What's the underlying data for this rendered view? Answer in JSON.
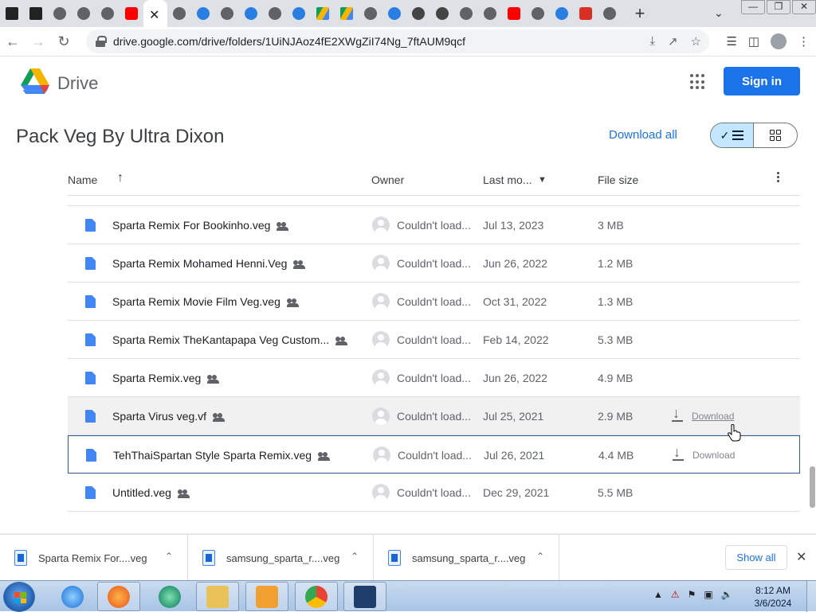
{
  "browser": {
    "url": "drive.google.com/drive/folders/1UiNJAoz4fE2XWgZiI74Ng_7ftAUM9qcf",
    "tab_close_glyph": "✕",
    "new_tab_glyph": "+",
    "tab_list_glyph": "⌄",
    "window_buttons": [
      "—",
      "❐",
      "✕"
    ],
    "tab_favicons": [
      "archive-icon",
      "archive-icon",
      "site-icon",
      "site-icon",
      "site-icon",
      "youtube-icon",
      "close-icon",
      "site-icon",
      "cloud-icon",
      "site-icon",
      "cloud-icon",
      "site-icon",
      "cloud-icon",
      "drive-icon",
      "drive-icon",
      "site-icon",
      "cloud-icon",
      "chrome-icon",
      "chrome-icon",
      "site-icon",
      "site-icon",
      "youtube-icon",
      "site-icon",
      "cloud-icon",
      "download-icon",
      "site-icon"
    ]
  },
  "drive": {
    "app_name": "Drive",
    "sign_in": "Sign in",
    "folder_title": "Pack Veg By Ultra Dixon",
    "download_all": "Download all",
    "columns": {
      "name": "Name",
      "owner": "Owner",
      "modified": "Last mo...",
      "size": "File size"
    },
    "files": [
      {
        "name": "Sparta Remix For Bookinho.veg",
        "owner": "Couldn't load...",
        "date": "Jul 13, 2023",
        "size": "3 MB"
      },
      {
        "name": "Sparta Remix Mohamed Henni.Veg",
        "owner": "Couldn't load...",
        "date": "Jun 26, 2022",
        "size": "1.2 MB"
      },
      {
        "name": "Sparta Remix Movie Film Veg.veg",
        "owner": "Couldn't load...",
        "date": "Oct 31, 2022",
        "size": "1.3 MB"
      },
      {
        "name": "Sparta Remix TheKantapapa Veg Custom...",
        "owner": "Couldn't load...",
        "date": "Feb 14, 2022",
        "size": "5.3 MB"
      },
      {
        "name": "Sparta Remix.veg",
        "owner": "Couldn't load...",
        "date": "Jun 26, 2022",
        "size": "4.9 MB"
      },
      {
        "name": "Sparta Virus veg.vf",
        "owner": "Couldn't load...",
        "date": "Jul 25, 2021",
        "size": "2.9 MB",
        "download": "Download"
      },
      {
        "name": "TehThaiSpartan Style Sparta Remix.veg",
        "owner": "Couldn't load...",
        "date": "Jul 26, 2021",
        "size": "4.4 MB",
        "download": "Download"
      },
      {
        "name": "Untitled.veg",
        "owner": "Couldn't load...",
        "date": "Dec 29, 2021",
        "size": "5.5 MB"
      }
    ]
  },
  "downloads": {
    "items": [
      "Sparta Remix For....veg",
      "samsung_sparta_r....veg",
      "samsung_sparta_r....veg"
    ],
    "show_all": "Show all"
  },
  "taskbar": {
    "time": "8:12 AM",
    "date": "3/6/2024"
  },
  "colors": {
    "accent": "#1a73e8",
    "selected_border": "#2d5c9a",
    "toggle_bg": "#c2e7ff"
  }
}
